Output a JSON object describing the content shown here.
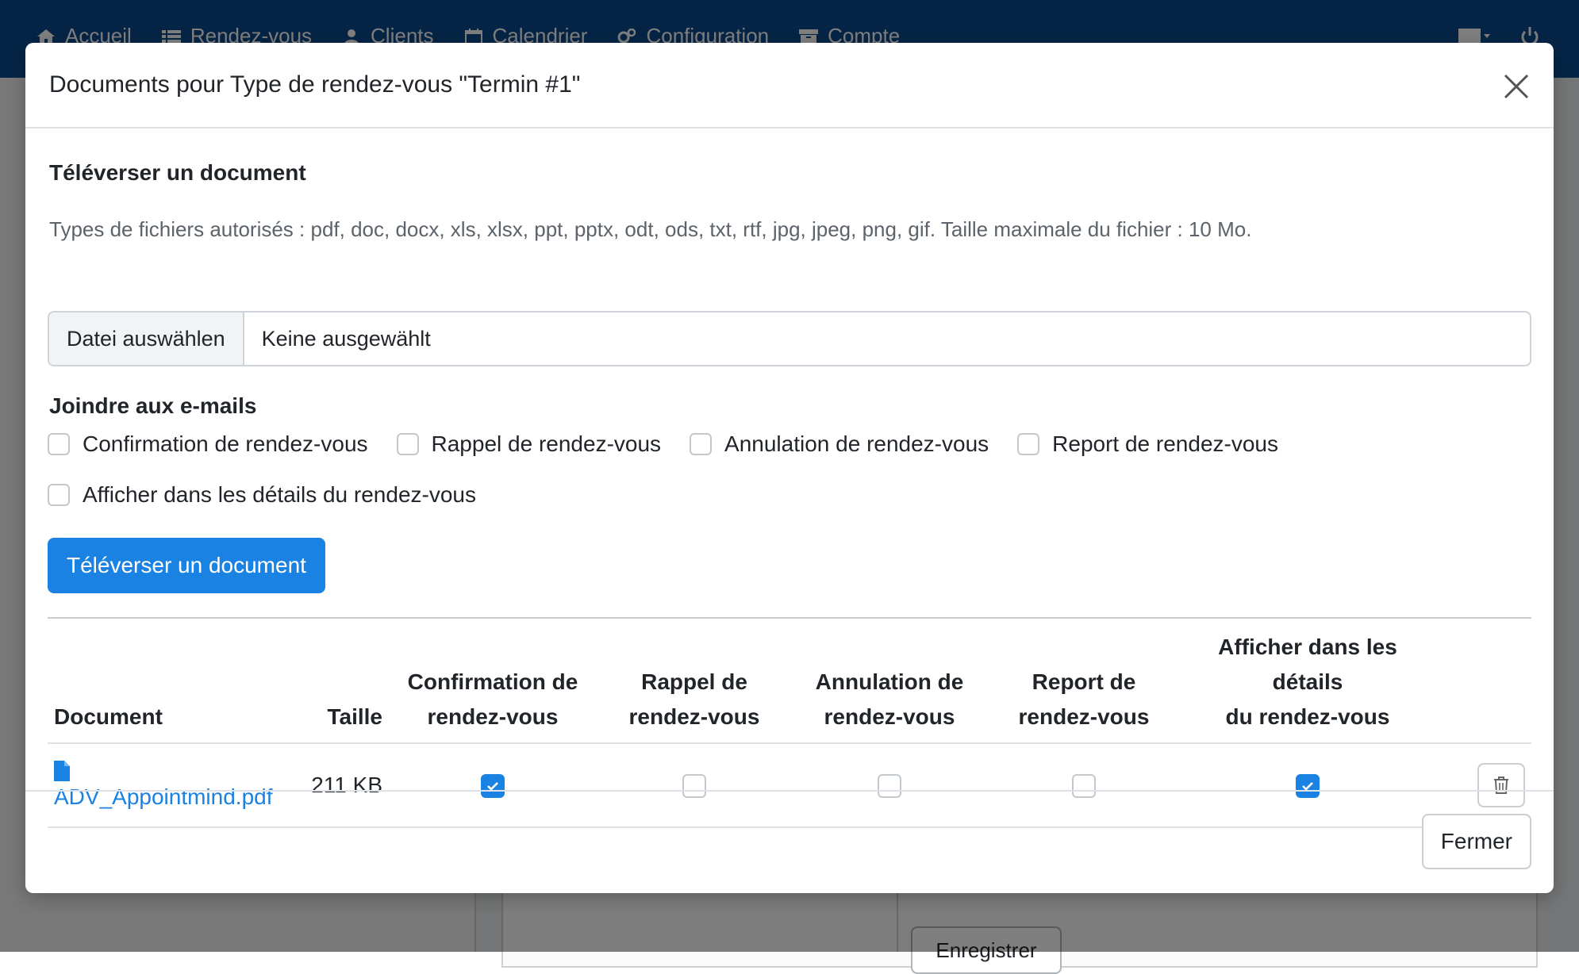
{
  "nav": {
    "items": [
      {
        "label": "Accueil",
        "icon": "home-icon"
      },
      {
        "label": "Rendez-vous",
        "icon": "list-icon"
      },
      {
        "label": "Clients",
        "icon": "user-icon"
      },
      {
        "label": "Calendrier",
        "icon": "calendar-icon"
      },
      {
        "label": "Configuration",
        "icon": "gears-icon"
      },
      {
        "label": "Compte",
        "icon": "archive-icon"
      }
    ],
    "right_icons": [
      "language-icon",
      "power-icon"
    ]
  },
  "background": {
    "save_label": "Enregistrer"
  },
  "modal": {
    "title": "Documents pour Type de rendez-vous \"Termin #1\"",
    "upload_section_title": "Téléverser un document",
    "help_text": "Types de fichiers autorisés : pdf, doc, docx, xls, xlsx, ppt, pptx, odt, ods, txt, rtf, jpg, jpeg, png, gif. Taille maximale du fichier : 10 Mo.",
    "file_input": {
      "button_label": "Datei auswählen",
      "status": "Keine ausgewählt"
    },
    "emails_title": "Joindre aux e-mails",
    "email_options": [
      {
        "label": "Confirmation de rendez-vous",
        "checked": false
      },
      {
        "label": "Rappel de rendez-vous",
        "checked": false
      },
      {
        "label": "Annulation de rendez-vous",
        "checked": false
      },
      {
        "label": "Report de rendez-vous",
        "checked": false
      }
    ],
    "details_option": {
      "label": "Afficher dans les détails du rendez-vous",
      "checked": false
    },
    "upload_button": "Téléverser un document",
    "table": {
      "headers": {
        "document": "Document",
        "size": "Taille",
        "confirmation_line1": "Confirmation de",
        "confirmation_line2": "rendez-vous",
        "reminder_line1": "Rappel de",
        "reminder_line2": "rendez-vous",
        "cancellation_line1": "Annulation de",
        "cancellation_line2": "rendez-vous",
        "reschedule_line1": "Report de",
        "reschedule_line2": "rendez-vous",
        "details_line1": "Afficher dans les détails",
        "details_line2": "du rendez-vous"
      },
      "rows": [
        {
          "filename": "ADV_Appointmind.pdf",
          "size": "211 KB",
          "confirmation": true,
          "reminder": false,
          "cancellation": false,
          "reschedule": false,
          "details": true
        }
      ]
    },
    "close_button": "Fermer"
  },
  "colors": {
    "primary": "#1a82e2",
    "navbar": "#0d4a8c"
  }
}
